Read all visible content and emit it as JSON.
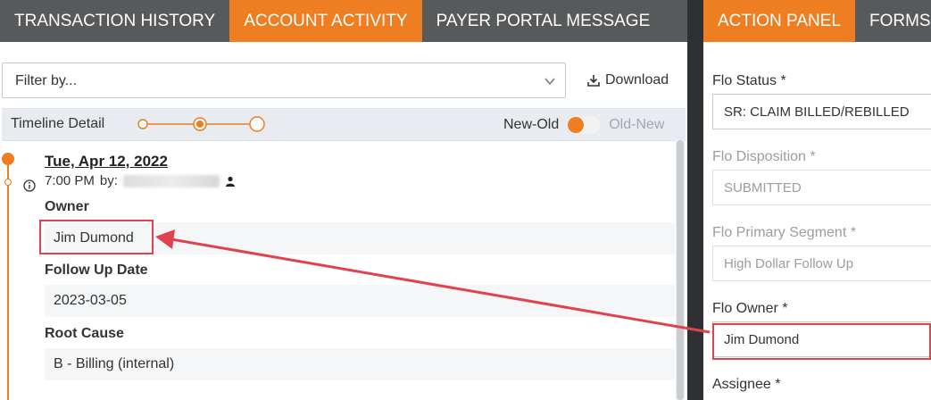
{
  "left_tabs": [
    {
      "label": "TRANSACTION HISTORY"
    },
    {
      "label": "ACCOUNT ACTIVITY"
    },
    {
      "label": "PAYER PORTAL MESSAGE"
    }
  ],
  "filter": {
    "placeholder": "Filter by..."
  },
  "download_label": "Download",
  "timeline": {
    "label": "Timeline Detail",
    "sort_new_old": "New-Old",
    "sort_old_new": "Old-New"
  },
  "entry": {
    "date": "Tue, Apr 12, 2022",
    "time": "7:00 PM",
    "by_label": "by:",
    "fields": [
      {
        "label": "Owner",
        "value": "Jim Dumond"
      },
      {
        "label": "Follow Up Date",
        "value": "2023-03-05"
      },
      {
        "label": "Root Cause",
        "value": "B - Billing (internal)"
      }
    ]
  },
  "right_tabs": [
    {
      "label": "ACTION PANEL"
    },
    {
      "label": "FORMS"
    }
  ],
  "action_panel": {
    "flo_status": {
      "label": "Flo Status *",
      "value": "SR: CLAIM BILLED/REBILLED"
    },
    "flo_disposition": {
      "label": "Flo Disposition *",
      "value": "SUBMITTED"
    },
    "flo_primary_segment": {
      "label": "Flo Primary Segment *",
      "value": "High Dollar Follow Up"
    },
    "flo_owner": {
      "label": "Flo Owner *",
      "value": "Jim Dumond"
    },
    "assignee": {
      "label": "Assignee *"
    }
  },
  "colors": {
    "accent": "#ef7d22",
    "tab_bar": "#58595b",
    "annotation": "#e0434e"
  }
}
